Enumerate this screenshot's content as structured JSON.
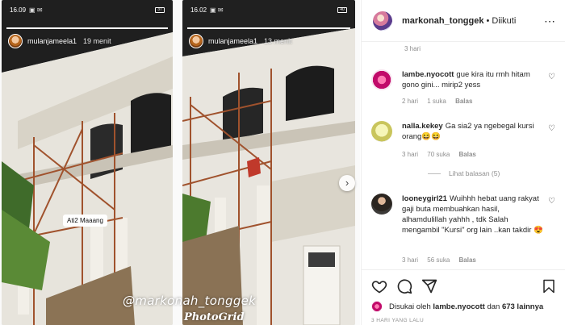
{
  "photo": {
    "left_story": {
      "status_time": "16.09",
      "battery": "37",
      "username": "mulanjameela1",
      "time_ago": "19 menit",
      "sticker": "Ati2 Maaang"
    },
    "right_story": {
      "status_time": "16.02",
      "battery": "40",
      "username": "mulanjameela1",
      "time_ago": "13 menit"
    },
    "watermark": "@markonah_tonggek",
    "photogrid": "PhotoGrid",
    "next_icon": "chevron-right"
  },
  "post": {
    "username": "markonah_tonggek",
    "separator": "•",
    "follow_status": "Diikuti",
    "more_icon": "ellipsis"
  },
  "comments": {
    "previous_meta": "3 hari",
    "items": [
      {
        "username": "lambe.nyocott",
        "text": "gue kira itu rmh hitam gono gini... mirip2 yess",
        "age": "2 hari",
        "likes": "1 suka",
        "reply": "Balas"
      },
      {
        "username": "nalla.kekey",
        "text": "Ga sia2 ya ngebegal kursi orang😆😆",
        "age": "3 hari",
        "likes": "70 suka",
        "reply": "Balas"
      },
      {
        "username": "looneygirl21",
        "text": "Wuihhh hebat uang rakyat gaji buta membuahkan hasil, alhamdulillah yahhh , tdk Salah mengambil \"Kursi\" org lain ..kan takdir 😍",
        "age": "3 hari",
        "likes": "56 suka",
        "reply": "Balas"
      }
    ],
    "see_replies": "Lihat balasan (5)"
  },
  "actions": {
    "liked_prefix": "Disukai oleh",
    "liked_by": "lambe.nyocott",
    "liked_conj": "dan",
    "liked_others": "673 lainnya",
    "timestamp": "3 HARI YANG LALU"
  }
}
